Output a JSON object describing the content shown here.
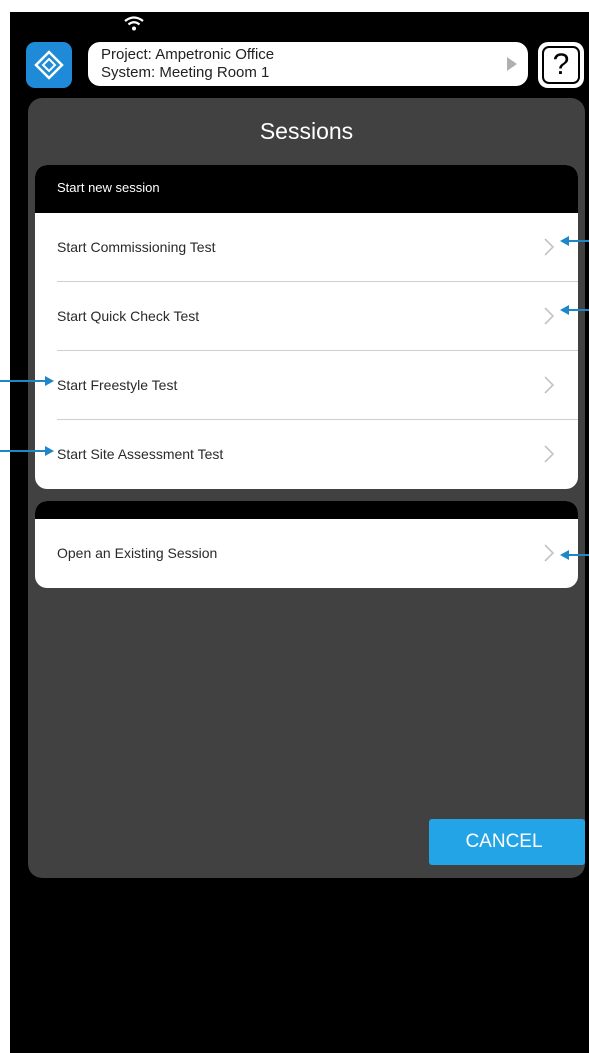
{
  "header": {
    "project_label": "Project: Ampetronic Office",
    "system_label": "System: Meeting Room 1",
    "help_symbol": "?"
  },
  "panel": {
    "title": "Sessions",
    "start_group": {
      "header": "Start new session",
      "items": [
        {
          "label": "Start Commissioning Test"
        },
        {
          "label": "Start Quick Check Test"
        },
        {
          "label": "Start Freestyle Test"
        },
        {
          "label": "Start Site Assessment Test"
        }
      ]
    },
    "existing_group": {
      "items": [
        {
          "label": "Open an Existing Session"
        }
      ]
    },
    "cancel_label": "CANCEL"
  },
  "icons": [
    "wifi-icon",
    "app-logo-icon",
    "play-arrow-icon",
    "help-icon",
    "chevron-right-icon"
  ],
  "colors": {
    "accent": "#23a4e6",
    "app_icon": "#1e8ad8",
    "panel": "#414141",
    "background": "#000000",
    "annotation_arrow": "#1f86c8"
  }
}
